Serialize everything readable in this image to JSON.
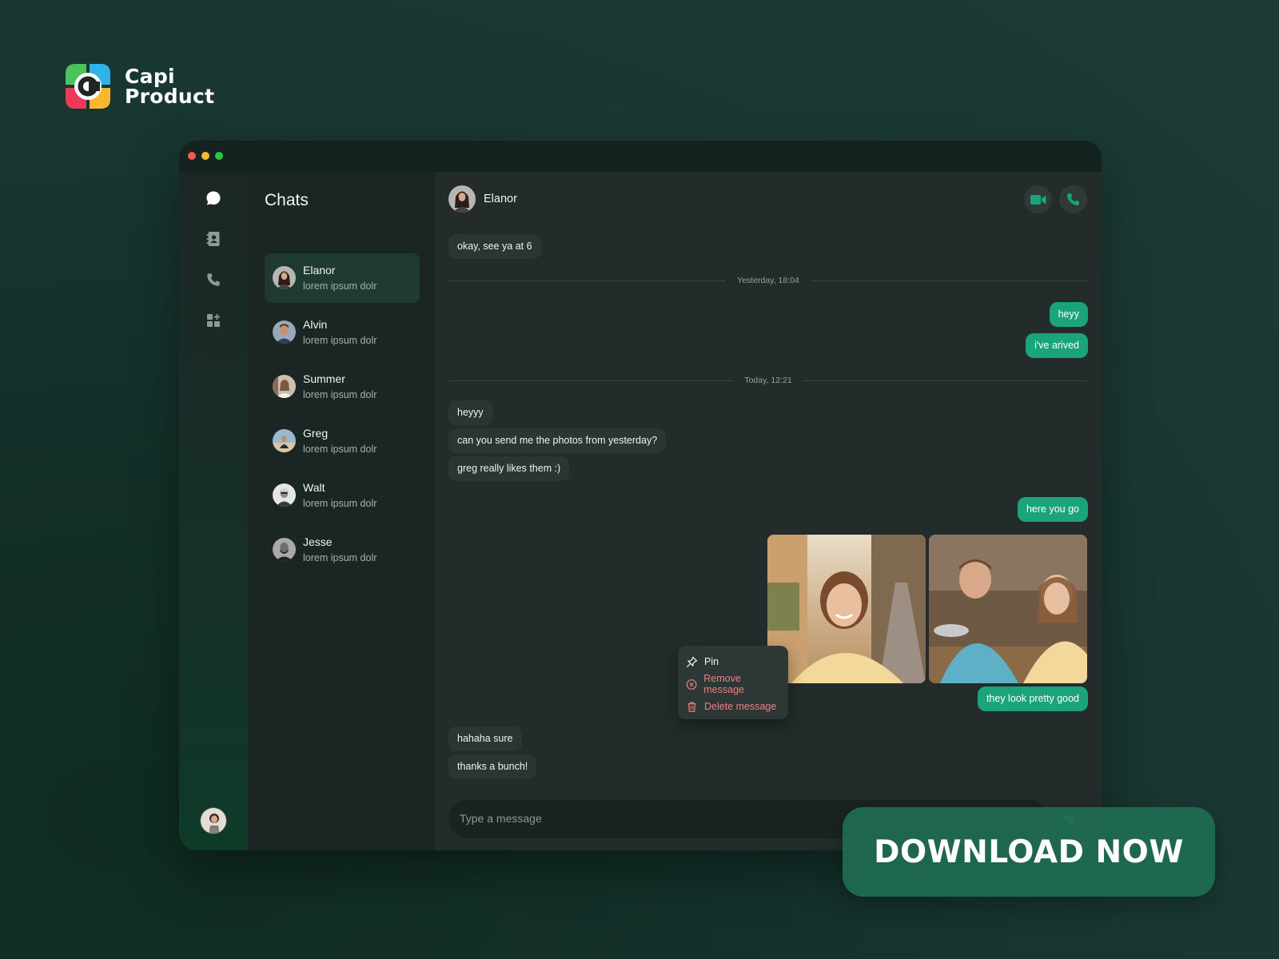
{
  "brand": {
    "line1": "Capi",
    "line2": "Product"
  },
  "window": {
    "controls": [
      "close",
      "minimize",
      "maximize"
    ]
  },
  "rail": {
    "items": [
      {
        "icon": "chat-bubble-icon",
        "active": true
      },
      {
        "icon": "contacts-book-icon",
        "active": false
      },
      {
        "icon": "phone-icon",
        "active": false
      },
      {
        "icon": "widgets-add-icon",
        "active": false
      }
    ]
  },
  "sidebar": {
    "title": "Chats",
    "chats": [
      {
        "name": "Elanor",
        "preview": "lorem ipsum dolr",
        "active": true
      },
      {
        "name": "Alvin",
        "preview": "lorem ipsum dolr",
        "active": false
      },
      {
        "name": "Summer",
        "preview": "lorem ipsum dolr",
        "active": false
      },
      {
        "name": "Greg",
        "preview": "lorem ipsum dolr",
        "active": false
      },
      {
        "name": "Walt",
        "preview": "lorem ipsum dolr",
        "active": false
      },
      {
        "name": "Jesse",
        "preview": "lorem ipsum dolr",
        "active": false
      }
    ]
  },
  "chat": {
    "contact_name": "Elanor",
    "dividers": [
      "Yesterday, 18:04",
      "Today, 12:21"
    ],
    "messages": [
      "okay, see ya at 6",
      "heyy",
      "i've arived",
      "heyyy",
      "can you send me the photos from yesterday?",
      "greg really likes them :)",
      "here you go",
      "they look pretty good",
      "hahaha sure",
      "thanks a bunch!"
    ],
    "context_menu": [
      "Pin",
      "Remove message",
      "Delete message"
    ],
    "composer_placeholder": "Type a message"
  },
  "cta": {
    "label": "DOWNLOAD NOW"
  },
  "colors": {
    "accent": "#1ba37a",
    "danger": "#ec7f7f",
    "background": "#1a3833",
    "panel": "#232c2b"
  }
}
